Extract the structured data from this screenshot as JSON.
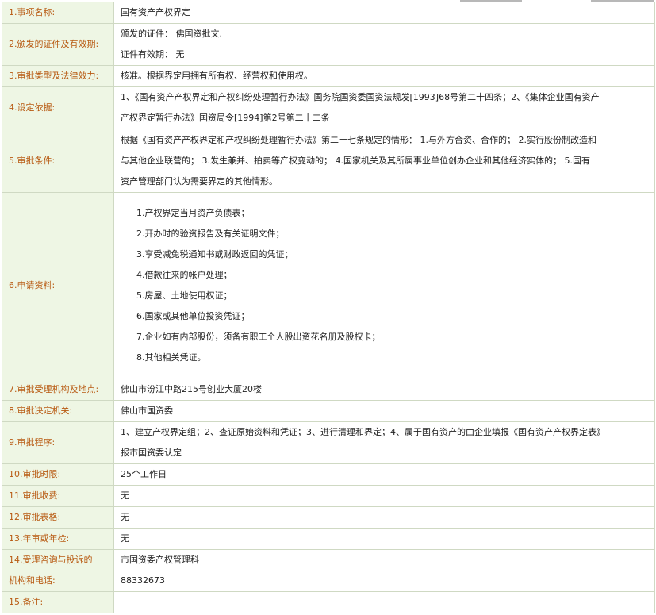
{
  "rows": [
    {
      "label": "1.事项名称:",
      "lines": [
        "国有资产产权界定"
      ]
    },
    {
      "label": "2.颁发的证件及有效期:",
      "lines": [
        "颁发的证件： 佛国资批文.",
        "证件有效期： 无"
      ]
    },
    {
      "label": "3.审批类型及法律效力:",
      "lines": [
        "核准。根据界定用拥有所有权、经营权和使用权。"
      ]
    },
    {
      "label": "4.设定依据:",
      "lines": [
        "1、《国有资产产权界定和产权纠纷处理暂行办法》国务院国资委国资法规发[1993]68号第二十四条；2、《集体企业国有资产",
        "产权界定暂行办法》国资局令[1994]第2号第二十二条"
      ]
    },
    {
      "label": "5.审批条件:",
      "lines": [
        "根据《国有资产产权界定和产权纠纷处理暂行办法》第二十七条规定的情形： 1.与外方合资、合作的； 2.实行股份制改造和",
        "与其他企业联营的； 3.发生兼并、拍卖等产权变动的； 4.国家机关及其所属事业单位创办企业和其他经济实体的； 5.国有",
        "资产管理部门认为需要界定的其他情形。"
      ]
    },
    {
      "label": "6.申请资料:",
      "items": [
        "1.产权界定当月资产负债表；",
        "2.开办时的验资报告及有关证明文件；",
        "3.享受减免税通知书或财政返回的凭证；",
        "4.借款往来的帐户处理；",
        "5.房屋、土地使用权证；",
        "6.国家或其他单位投资凭证；",
        "7.企业如有内部股份，须备有职工个人股出资花名册及股权卡；",
        "8.其他相关凭证。"
      ]
    },
    {
      "label": "7.审批受理机构及地点:",
      "lines": [
        "佛山市汾江中路215号创业大厦20楼"
      ]
    },
    {
      "label": "8.审批决定机关:",
      "lines": [
        "佛山市国资委"
      ]
    },
    {
      "label": "9.审批程序:",
      "lines": [
        "1、建立产权界定组；2、查证原始资料和凭证；3、进行清理和界定；4、属于国有资产的由企业填报《国有资产产权界定表》",
        "报市国资委认定"
      ]
    },
    {
      "label": "10.审批时限:",
      "lines": [
        "25个工作日"
      ]
    },
    {
      "label": "11.审批收费:",
      "lines": [
        "无"
      ]
    },
    {
      "label": "12.审批表格:",
      "lines": [
        "无"
      ]
    },
    {
      "label": "13.年审或年检:",
      "lines": [
        "无"
      ]
    },
    {
      "label": "14.受理咨询与投诉的机构和电话:",
      "label_lines": [
        "14.受理咨询与投诉的",
        "机构和电话:"
      ],
      "lines": [
        "市国资委产权管理科",
        "88332673"
      ]
    },
    {
      "label": "15.备注:",
      "lines": [
        ""
      ]
    }
  ],
  "colors": {
    "label_bg": "#eef6e4",
    "label_text": "#b85a12",
    "border": "#cfd9c3"
  }
}
